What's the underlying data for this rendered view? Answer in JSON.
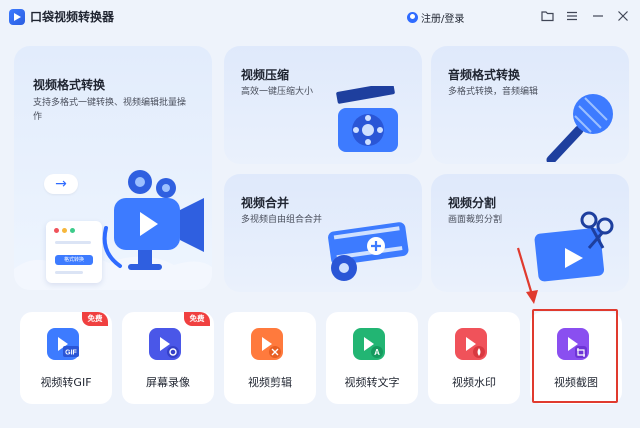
{
  "app": {
    "title": "口袋视频转换器",
    "login": "注册/登录"
  },
  "features": {
    "format": {
      "title": "视频格式转换",
      "desc": "支持多格式一键转换、视频编辑批量操作",
      "panel_pill": "格式转换"
    },
    "compress": {
      "title": "视频压缩",
      "desc": "高效一键压缩大小"
    },
    "audio": {
      "title": "音频格式转换",
      "desc": "多格式转换，音频编辑"
    },
    "merge": {
      "title": "视频合并",
      "desc": "多视频自由组合合并"
    },
    "split": {
      "title": "视频分割",
      "desc": "画面裁剪分割"
    }
  },
  "tools": [
    {
      "label": "视频转GIF",
      "badge": "免费",
      "icon": "gif-icon",
      "color": "#3d7bff",
      "glyph": "GIF"
    },
    {
      "label": "屏幕录像",
      "badge": "免费",
      "icon": "screen-record-icon",
      "color": "#4a57e8",
      "glyph": "◉"
    },
    {
      "label": "视频剪辑",
      "icon": "scissors-icon",
      "color": "#ff7a3d",
      "glyph": "✂"
    },
    {
      "label": "视频转文字",
      "icon": "text-icon",
      "color": "#22b573",
      "glyph": "A"
    },
    {
      "label": "视频水印",
      "icon": "watermark-icon",
      "color": "#f0525a",
      "glyph": "◆"
    },
    {
      "label": "视频截图",
      "icon": "crop-icon",
      "color": "#8a4ff0",
      "glyph": "⌗"
    }
  ],
  "colors": {
    "accent": "#2f6bff",
    "badge": "#f04040",
    "highlight": "#e03a2e"
  }
}
